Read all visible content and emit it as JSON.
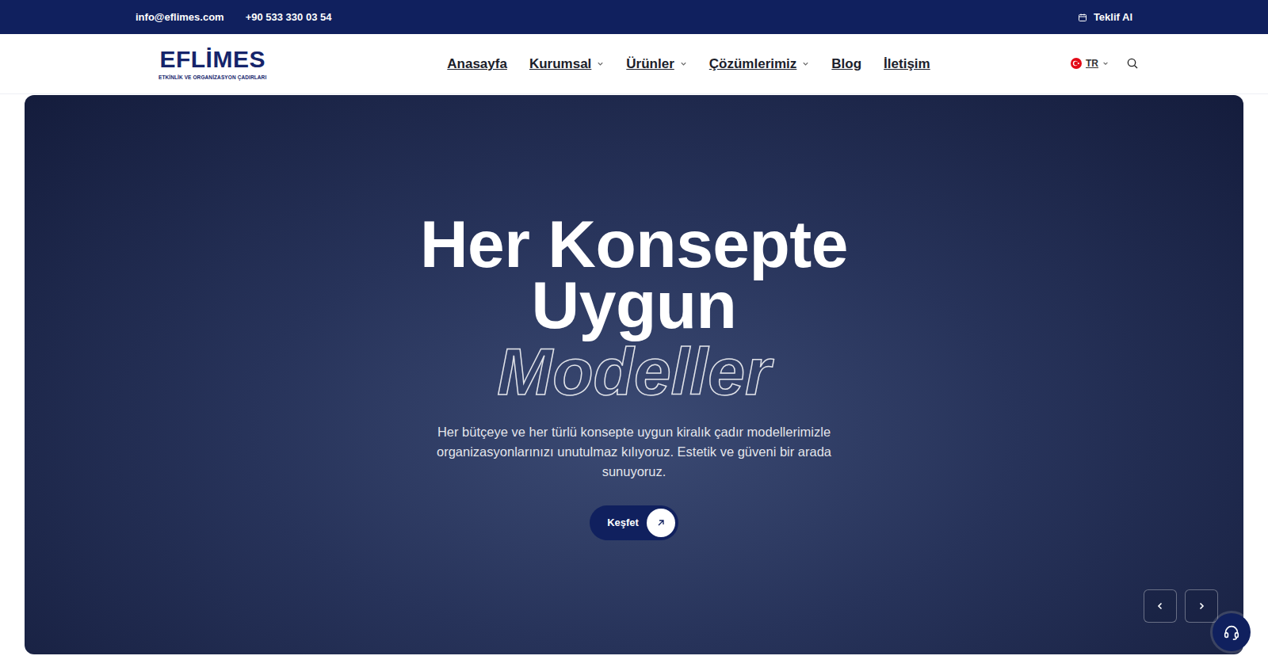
{
  "topbar": {
    "email": "info@eflimes.com",
    "phone": "+90 533 330 03 54",
    "cta": "Teklif Al"
  },
  "logo": {
    "name": "EFLİMES",
    "tagline": "ETKİNLİK VE ORGANİZASYON ÇADIRLARI"
  },
  "nav": {
    "items": [
      {
        "label": "Anasayfa",
        "has_menu": false
      },
      {
        "label": "Kurumsal",
        "has_menu": true
      },
      {
        "label": "Ürünler",
        "has_menu": true
      },
      {
        "label": "Çözümlerimiz",
        "has_menu": true
      },
      {
        "label": "Blog",
        "has_menu": false
      },
      {
        "label": "İletişim",
        "has_menu": false
      }
    ]
  },
  "language": {
    "code": "TR"
  },
  "hero": {
    "title_lines": [
      "Her Konsepte",
      "Uygun"
    ],
    "outline": "Modeller",
    "text": "Her bütçeye ve her türlü konsepte uygun kiralık çadır modellerimizle organizasyonlarınızı unutulmaz kılıyoruz. Estetik ve güveni bir arada sunuyoruz.",
    "button": "Keşfet"
  }
}
